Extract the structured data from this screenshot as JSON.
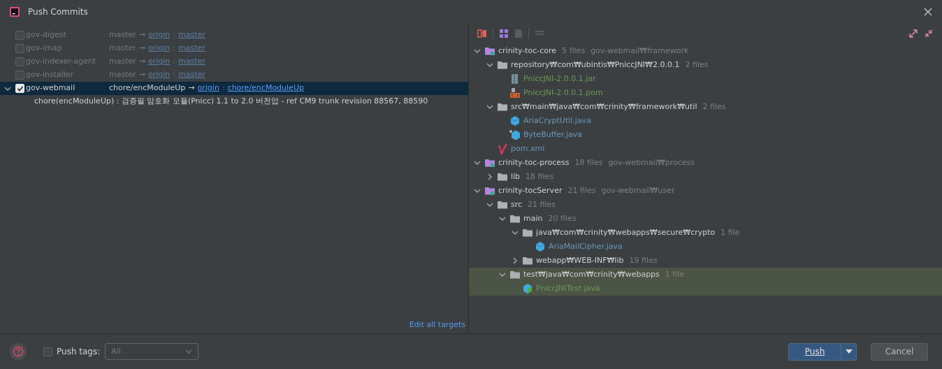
{
  "window": {
    "title": "Push Commits"
  },
  "repositories": [
    {
      "name": "gov-digest",
      "checked": false,
      "selected": false,
      "expanded": false,
      "source": "master",
      "arrow": "→",
      "remote": "origin",
      "separator": ":",
      "target": "master"
    },
    {
      "name": "gov-imap",
      "checked": false,
      "selected": false,
      "expanded": false,
      "source": "master",
      "arrow": "→",
      "remote": "origin",
      "separator": ":",
      "target": "master"
    },
    {
      "name": "gov-indexer-agent",
      "checked": false,
      "selected": false,
      "expanded": false,
      "source": "master",
      "arrow": "→",
      "remote": "origin",
      "separator": ":",
      "target": "master"
    },
    {
      "name": "gov-installer",
      "checked": false,
      "selected": false,
      "expanded": false,
      "source": "master",
      "arrow": "→",
      "remote": "origin",
      "separator": ":",
      "target": "master"
    },
    {
      "name": "gov-webmail",
      "checked": true,
      "selected": true,
      "expanded": true,
      "source": "chore/encModuleUp",
      "arrow": "→",
      "remote": "origin",
      "separator": ":",
      "target": "chore/encModuleUp",
      "commits": [
        "chore(encModuleUp) : 검증필 암호화 모듈(Pnicc) 1.1 to 2.0 버전업 - ref CM9 trunk revision 88567, 88590"
      ]
    }
  ],
  "edit_all_targets": "Edit all targets",
  "tree": [
    {
      "kind": "module",
      "label": "crinity-toc-core",
      "count": "5 files",
      "path": "gov-webmail₩framework",
      "expanded": true,
      "selected": false,
      "children": [
        {
          "kind": "folder",
          "label": "repository₩com₩ubintis₩PniccJNI₩2.0.0.1",
          "count": "2 files",
          "expanded": true,
          "selected": false,
          "children": [
            {
              "kind": "jar",
              "label": "PniccJNI-2.0.0.1.jar",
              "color": "#6a9955",
              "selected": false
            },
            {
              "kind": "pom",
              "label": "PniccJNI-2.0.0.1.pom",
              "color": "#6a9955",
              "selected": false
            }
          ]
        },
        {
          "kind": "folder",
          "label": "src₩main₩java₩com₩crinity₩framework₩util",
          "count": "2 files",
          "expanded": true,
          "selected": false,
          "children": [
            {
              "kind": "java",
              "label": "AriaCryptUtil.java",
              "color": "#6897bb",
              "selected": false
            },
            {
              "kind": "java-new",
              "label": "ByteBuffer.java",
              "color": "#6897bb",
              "selected": false
            }
          ]
        },
        {
          "kind": "maven",
          "label": "pom.xml",
          "color": "#6897bb",
          "selected": false
        }
      ]
    },
    {
      "kind": "module",
      "label": "crinity-toc-process",
      "count": "18 files",
      "path": "gov-webmail₩process",
      "expanded": true,
      "selected": false,
      "children": [
        {
          "kind": "folder",
          "label": "lib",
          "count": "18 files",
          "expanded": false,
          "selected": false
        }
      ]
    },
    {
      "kind": "module",
      "label": "crinity-tocServer",
      "count": "21 files",
      "path": "gov-webmail₩user",
      "expanded": true,
      "selected": false,
      "children": [
        {
          "kind": "folder",
          "label": "src",
          "count": "21 files",
          "expanded": true,
          "selected": false,
          "children": [
            {
              "kind": "folder",
              "label": "main",
              "count": "20 files",
              "expanded": true,
              "selected": false,
              "children": [
                {
                  "kind": "folder",
                  "label": "java₩com₩crinity₩webapps₩secure₩crypto",
                  "count": "1 file",
                  "expanded": true,
                  "selected": false,
                  "children": [
                    {
                      "kind": "java",
                      "label": "AriaMailCipher.java",
                      "color": "#6897bb",
                      "selected": false
                    }
                  ]
                },
                {
                  "kind": "folder",
                  "label": "webapp₩WEB-INF₩lib",
                  "count": "19 files",
                  "expanded": false,
                  "selected": false
                }
              ]
            },
            {
              "kind": "folder",
              "label": "test₩java₩com₩crinity₩webapps",
              "count": "1 file",
              "expanded": true,
              "selected": true,
              "children": [
                {
                  "kind": "java-test",
                  "label": "PniccJNITest.java",
                  "color": "#6a9955",
                  "selected": true
                }
              ]
            }
          ]
        }
      ]
    }
  ],
  "footer": {
    "push_tags": {
      "label": "Push tags:",
      "checked": false
    },
    "tags_dropdown": {
      "value": "All",
      "disabled": true
    },
    "buttons": [
      {
        "kind": "split-primary",
        "label": "Push"
      },
      {
        "kind": "plain",
        "label": "Cancel"
      }
    ]
  }
}
